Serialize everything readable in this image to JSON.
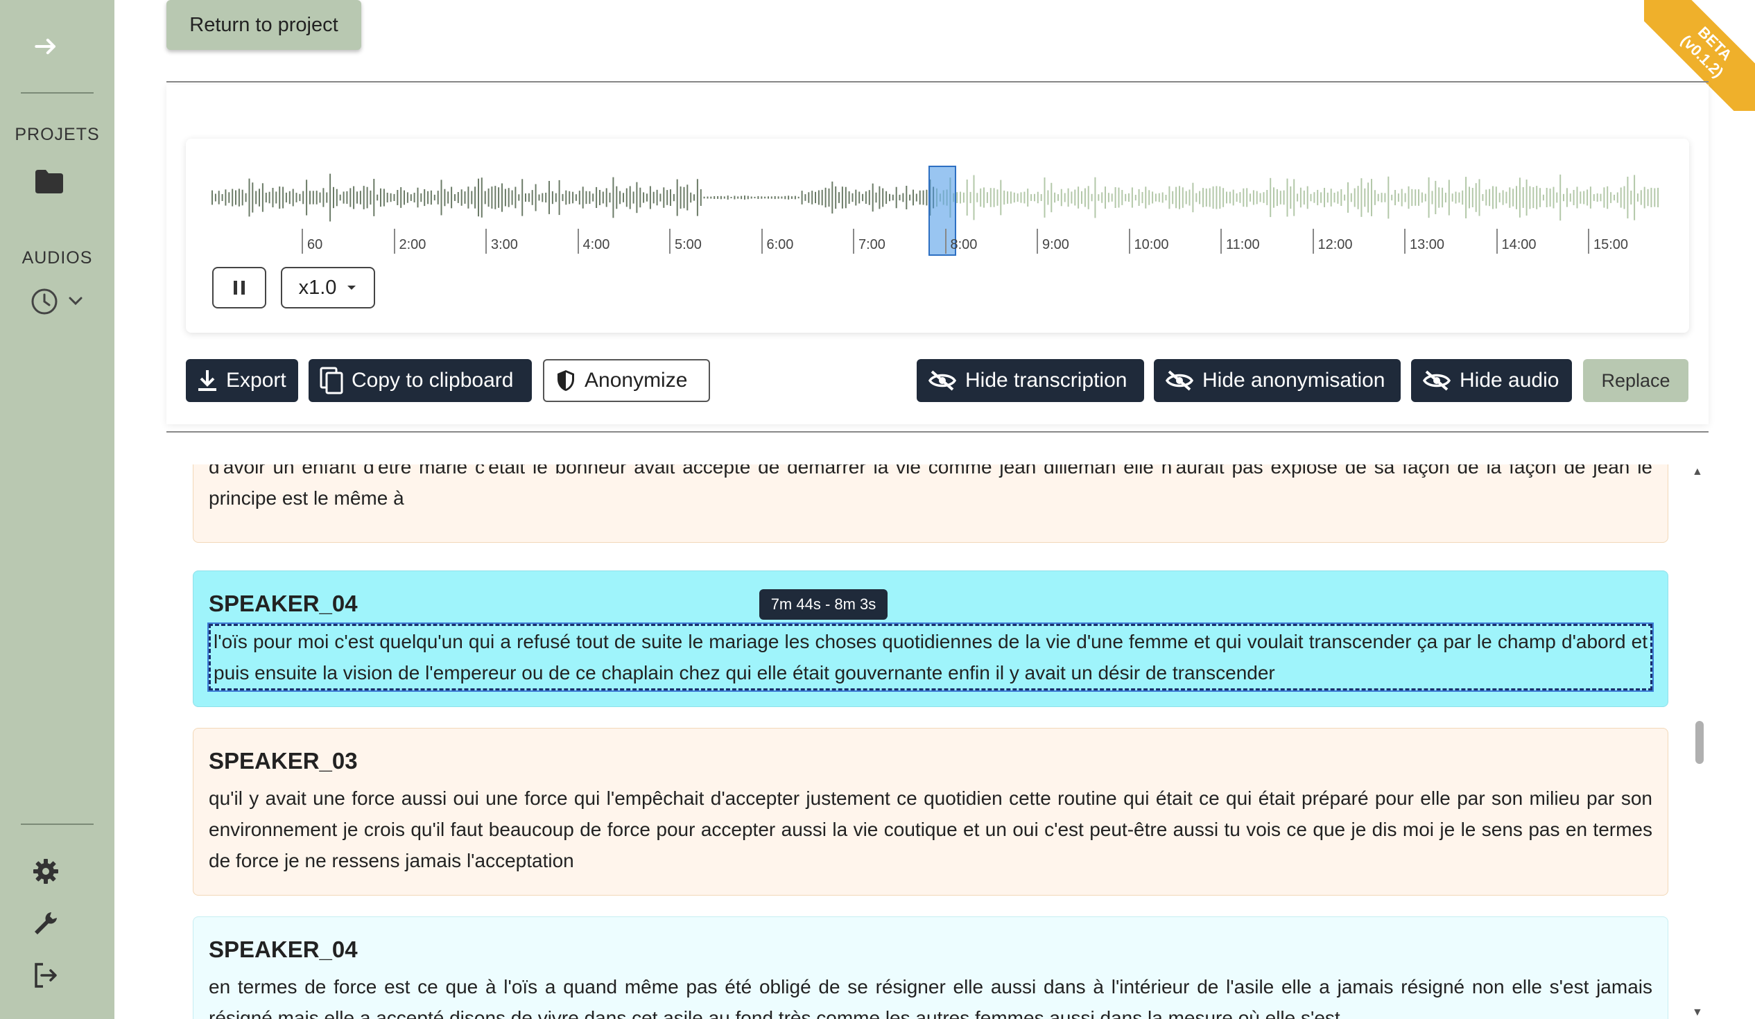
{
  "sidebar": {
    "projects_label": "PROJETS",
    "audios_label": "AUDIOS",
    "icons": [
      "arrow-right-icon",
      "folder-icon",
      "clock-icon",
      "chevron-down-icon",
      "gear-icon",
      "wrench-icon",
      "logout-icon"
    ]
  },
  "beta_badge": {
    "line1": "BETA",
    "line2": "(v0.1.2)"
  },
  "header": {
    "return_label": "Return to project"
  },
  "player": {
    "timeline_ticks": [
      "60",
      "2:00",
      "3:00",
      "4:00",
      "5:00",
      "6:00",
      "7:00",
      "8:00",
      "9:00",
      "10:00",
      "11:00",
      "12:00",
      "13:00",
      "14:00",
      "15:00"
    ],
    "speed_label": "x1.0",
    "playback_fraction": 0.5
  },
  "toolbar": {
    "export_label": "Export",
    "copy_label": "Copy to clipboard",
    "anonymize_label": "Anonymize",
    "hide_transcription_label": "Hide transcription",
    "hide_anonymisation_label": "Hide anonymisation",
    "hide_audio_label": "Hide audio",
    "replace_label": "Replace"
  },
  "transcript": {
    "segments": [
      {
        "speaker": "",
        "text": "d'avoir un enfant d'être marié c'était le bonheur avait accepté de démarrer la vie comme jean dilleman elle n'aurait pas explosé de sa façon de la façon de jean le principe est le même à"
      },
      {
        "speaker": "SPEAKER_04",
        "text": "l'oïs pour moi c'est quelqu'un qui a refusé tout de suite le mariage les choses quotidiennes de la vie d'une femme et qui voulait transcender ça par le champ d'abord et puis ensuite la vision de l'empereur ou de ce chaplain chez qui elle était gouvernante enfin il y avait un désir de transcender"
      },
      {
        "speaker": "SPEAKER_03",
        "text": "qu'il y avait une force aussi oui une force qui l'empêchait d'accepter justement ce quotidien cette routine qui était ce qui était préparé pour elle par son milieu par son environnement je crois qu'il faut beaucoup de force pour accepter aussi la vie coutique et un oui c'est peut-être aussi tu vois ce que je dis moi je le sens pas en termes de force je ne ressens jamais l'acceptation"
      },
      {
        "speaker": "SPEAKER_04",
        "text": "en termes de force est ce que à l'oïs a quand même pas été obligé de se résigner elle aussi dans à l'intérieur de l'asile elle a jamais résigné non elle s'est jamais résigné mais elle a accepté disons de vivre dans cet asile au fond très comme les autres femmes aussi dans la mesure où elle s'est"
      }
    ],
    "active_tooltip": "7m 44s - 8m 3s"
  }
}
